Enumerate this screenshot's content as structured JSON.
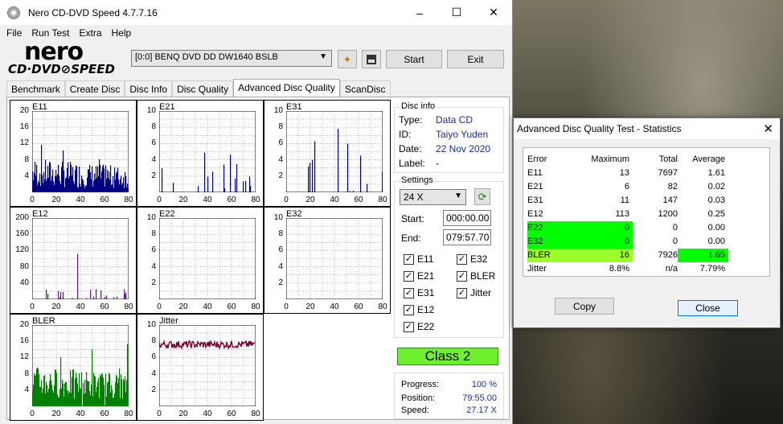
{
  "window": {
    "title": "Nero CD-DVD Speed 4.7.7.16",
    "controls": {
      "minimize": "–",
      "maximize": "☐",
      "close": "✕"
    }
  },
  "menu": [
    "File",
    "Run Test",
    "Extra",
    "Help"
  ],
  "logo": {
    "main": "nero",
    "sub": "CD·DVD⊘SPEED"
  },
  "toolbar": {
    "drive": "[0:0]   BENQ DVD DD DW1640 BSLB",
    "start_label": "Start",
    "exit_label": "Exit"
  },
  "tabs": [
    "Benchmark",
    "Create Disc",
    "Disc Info",
    "Disc Quality",
    "Advanced Disc Quality",
    "ScanDisc"
  ],
  "active_tab": "Advanced Disc Quality",
  "charts": [
    {
      "name": "E11",
      "yticks": [
        "20",
        "16",
        "12",
        "8",
        "4"
      ],
      "ymax": 20,
      "color": "#000080",
      "type": "bars"
    },
    {
      "name": "E21",
      "yticks": [
        "10",
        "8",
        "6",
        "4",
        "2"
      ],
      "ymax": 10,
      "color": "#000080",
      "type": "bars"
    },
    {
      "name": "E31",
      "yticks": [
        "10",
        "8",
        "6",
        "4",
        "2"
      ],
      "ymax": 10,
      "color": "#000080",
      "type": "bars"
    },
    {
      "name": "E12",
      "yticks": [
        "200",
        "160",
        "120",
        "80",
        "40"
      ],
      "ymax": 200,
      "color": "#5a1a7a",
      "type": "bars"
    },
    {
      "name": "E22",
      "yticks": [
        "10",
        "8",
        "6",
        "4",
        "2"
      ],
      "ymax": 10,
      "color": "#000080",
      "type": "empty"
    },
    {
      "name": "E32",
      "yticks": [
        "10",
        "8",
        "6",
        "4",
        "2"
      ],
      "ymax": 10,
      "color": "#000080",
      "type": "empty"
    },
    {
      "name": "BLER",
      "yticks": [
        "20",
        "16",
        "12",
        "8",
        "4"
      ],
      "ymax": 20,
      "color": "#008000",
      "type": "bars"
    },
    {
      "name": "Jitter",
      "yticks": [
        "10",
        "8",
        "6",
        "4",
        "2"
      ],
      "ymax": 10,
      "color": "#7a0030",
      "type": "line"
    }
  ],
  "xticks": [
    "0",
    "20",
    "40",
    "60",
    "80"
  ],
  "disc_info": {
    "title": "Disc info",
    "type_label": "Type:",
    "type": "Data CD",
    "id_label": "ID:",
    "id": "Taiyo Yuden",
    "date_label": "Date:",
    "date": "22 Nov 2020",
    "label_label": "Label:",
    "label": "-"
  },
  "settings": {
    "title": "Settings",
    "speed": "24 X",
    "start_label": "Start:",
    "start": "000:00.00",
    "end_label": "End:",
    "end": "079:57.70",
    "checkboxes": [
      {
        "label": "E11",
        "checked": true
      },
      {
        "label": "E32",
        "checked": true
      },
      {
        "label": "E21",
        "checked": true
      },
      {
        "label": "BLER",
        "checked": true
      },
      {
        "label": "E31",
        "checked": true
      },
      {
        "label": "Jitter",
        "checked": true
      },
      {
        "label": "E12",
        "checked": true
      },
      {
        "label": "E22",
        "checked": true
      }
    ]
  },
  "class_label": "Class 2",
  "progress": {
    "progress_label": "Progress:",
    "progress": "100 %",
    "position_label": "Position:",
    "position": "79:55.00",
    "speed_label": "Speed:",
    "speed": "27.17 X"
  },
  "stats_dialog": {
    "title": "Advanced Disc Quality Test - Statistics",
    "headers": [
      "Error",
      "Maximum",
      "Total",
      "Average"
    ],
    "rows": [
      {
        "error": "E11",
        "max": "13",
        "total": "7697",
        "avg": "1.61"
      },
      {
        "error": "E21",
        "max": "6",
        "total": "82",
        "avg": "0.02"
      },
      {
        "error": "E31",
        "max": "11",
        "total": "147",
        "avg": "0.03"
      },
      {
        "error": "E12",
        "max": "113",
        "total": "1200",
        "avg": "0.25"
      },
      {
        "error": "E22",
        "max": "0",
        "total": "0",
        "avg": "0.00"
      },
      {
        "error": "E32",
        "max": "0",
        "total": "0",
        "avg": "0.00"
      },
      {
        "error": "BLER",
        "max": "16",
        "total": "7926",
        "avg": "1.65"
      },
      {
        "error": "Jitter",
        "max": "8.8%",
        "total": "n/a",
        "avg": "7.79%"
      }
    ],
    "highlight_color": "#00ff00",
    "bler_highlight_color": "#9cff2c",
    "copy_label": "Copy",
    "close_label": "Close"
  }
}
